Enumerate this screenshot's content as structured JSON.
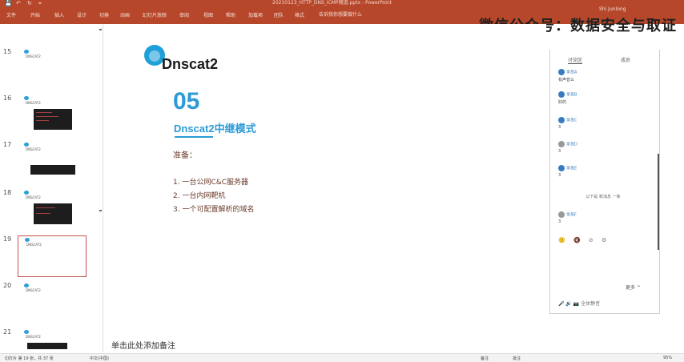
{
  "window": {
    "title": "20210123_HTTP_DNS_ICMP隧道.pptx - PowerPoint",
    "user": "Shi Junlong"
  },
  "quick_access": [
    "💾",
    "↶",
    "↻",
    "⌖"
  ],
  "ribbon": {
    "tabs": [
      "文件",
      "开始",
      "插入",
      "设计",
      "切换",
      "动画",
      "幻灯片放映",
      "审阅",
      "视图",
      "帮助",
      "加载项",
      "团队",
      "格式",
      "屏幕录制"
    ],
    "search": "告诉我你想要做什么"
  },
  "watermark": "微信公众号：数据安全与取证",
  "thumbnails": [
    {
      "num": "15",
      "title": "DNSCAT2"
    },
    {
      "num": "16",
      "title": "DNSCAT2"
    },
    {
      "num": "17",
      "title": "DNSCAT2"
    },
    {
      "num": "18",
      "title": "DNSCAT2"
    },
    {
      "num": "19",
      "title": "DNSCAT2"
    },
    {
      "num": "20",
      "title": "DNSCAT2"
    },
    {
      "num": "21",
      "title": "DNSCAT2"
    }
  ],
  "slide": {
    "logo_text": "Dnscat2",
    "section_number": "05",
    "section_title": "Dnscat2中继模式",
    "prep_label": "准备：",
    "items": [
      "1. 一台公网C&C服务器",
      "2. 一台内网靶机",
      "3. 一个可配置解析的域名"
    ]
  },
  "comments": {
    "tabs": [
      "讨论区",
      "成员"
    ],
    "entries": [
      {
        "name": "学员A",
        "text": "有声音么"
      },
      {
        "name": "学员B",
        "text": "好的"
      },
      {
        "name": "学员C",
        "text": "3"
      },
      {
        "name": "学员D",
        "text": "3"
      },
      {
        "name": "学员E",
        "text": "3"
      }
    ],
    "separator": "以下是 新消息 一条",
    "last_entry": {
      "name": "学员F",
      "text": "3"
    },
    "actions": "🙂 🔇 ⊘ ⚙",
    "more_label": "更多 ^",
    "bottom": "🎤 🔊 📷 全体静音"
  },
  "notes_placeholder": "单击此处添加备注",
  "status": {
    "slide_info": "幻灯片 第 19 张，共 37 张",
    "language": "中文(中国)",
    "notes_btn": "备注",
    "comments_btn": "批注",
    "zoom": "95%"
  }
}
